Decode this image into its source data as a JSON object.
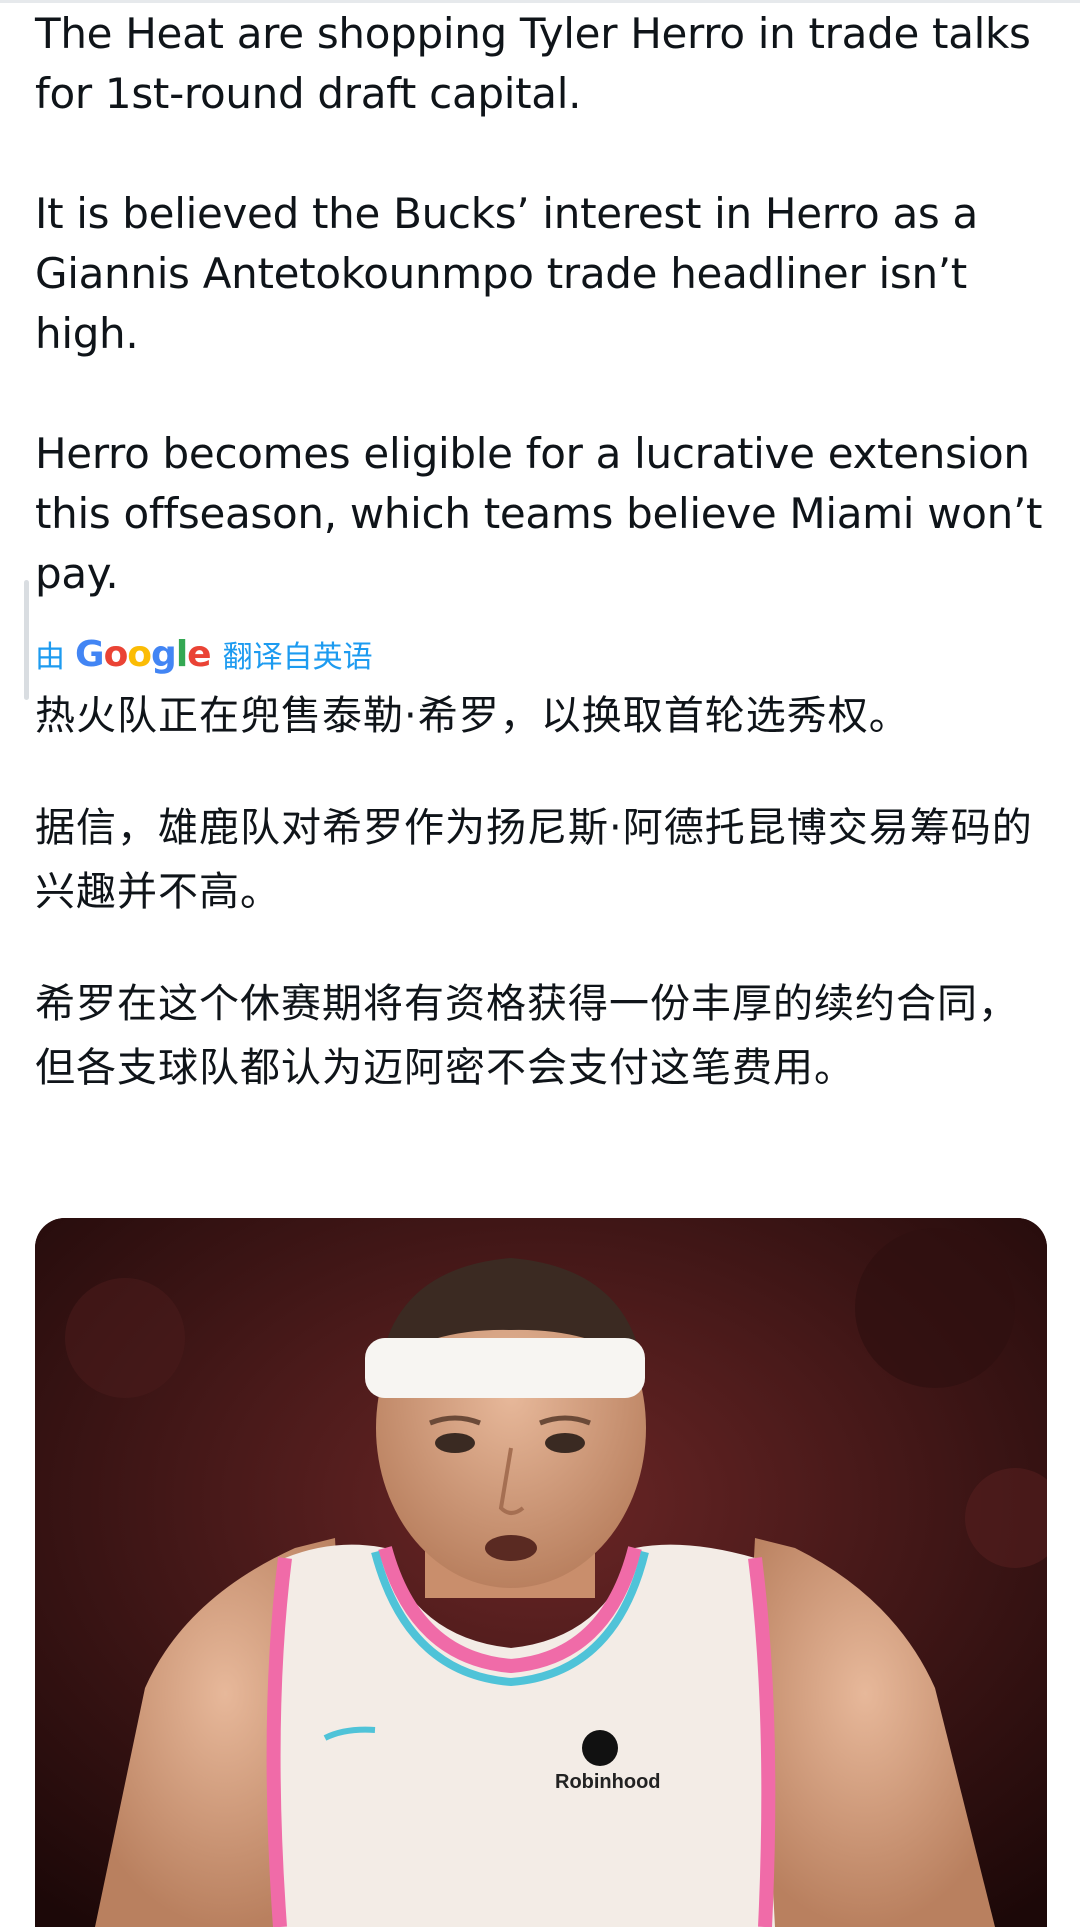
{
  "tweet": {
    "original_paragraphs": [
      "The Heat are shopping Tyler Herro in trade talks for 1st-round draft capital.",
      "It is believed the Bucks’ interest in Herro as a Giannis Antetokounmpo trade headliner isn’t high.",
      "Herro becomes eligible for a lucrative extension this offseason, which teams believe Miami won’t pay."
    ],
    "translation_bar": {
      "by": "由",
      "provider_letters": [
        "G",
        "o",
        "o",
        "g",
        "l",
        "e"
      ],
      "label": "翻译自英语"
    },
    "translated_paragraphs": [
      "热火队正在兜售泰勒·希罗，以换取首轮选秀权。",
      "据信，雄鹿队对希罗作为扬尼斯·阿德托昆博交易筹码的兴趣并不高。",
      "希罗在这个休赛期将有资格获得一份丰厚的续约合同，但各支球队都认为迈阿密不会支付这笔费用。"
    ],
    "media": {
      "jersey_sponsor": "Robinhood"
    }
  },
  "colors": {
    "text": "#0f1419",
    "link_blue": "#1d9bf0",
    "google_blue": "#4285f4",
    "google_red": "#ea4335",
    "google_yellow": "#fbbc05",
    "google_green": "#34a853"
  }
}
